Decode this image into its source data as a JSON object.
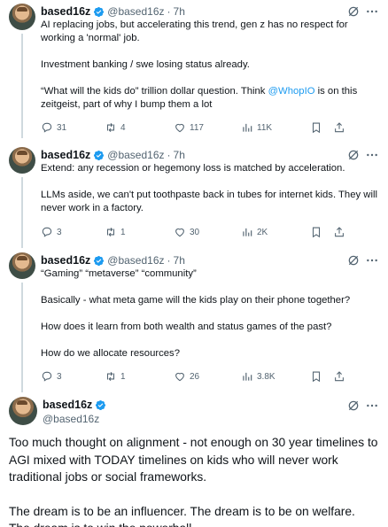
{
  "user": {
    "name": "based16z",
    "handle": "@based16z"
  },
  "colors": {
    "text": "#0f1419",
    "muted": "#536471",
    "link": "#1d9bf0",
    "verified": "#1d9bf0"
  },
  "tweets": [
    {
      "time": "7h",
      "paragraphs": [
        "AI replacing jobs, but accelerating this trend, gen z has no respect for working a 'normal' job.",
        "Investment banking / swe losing status already.",
        "“What will the kids do” trillion dollar question. Think "
      ],
      "mention": "@WhopIO",
      "after_mention": " is on this zeitgeist, part of why I bump them a lot",
      "replies": "31",
      "reposts": "4",
      "likes": "117",
      "views": "11K"
    },
    {
      "time": "7h",
      "paragraphs": [
        "Extend: any recession or hegemony loss is matched by acceleration.",
        "LLMs aside, we can't put toothpaste back in tubes for internet kids. They will never work in a factory."
      ],
      "replies": "3",
      "reposts": "1",
      "likes": "30",
      "views": "2K"
    },
    {
      "time": "7h",
      "paragraphs": [
        "“Gaming” “metaverse” “community”",
        "Basically - what meta game will the kids play on their phone together?",
        "How does it learn from both wealth and status games of the past?",
        "How do we allocate resources?"
      ],
      "replies": "3",
      "reposts": "1",
      "likes": "26",
      "views": "3.8K"
    }
  ],
  "main_tweet": {
    "paragraphs": [
      "Too much thought on alignment - not enough on 30 year timelines to AGI mixed with TODAY timelines on kids who will never work traditional jobs or social frameworks.",
      "The dream is to be an influencer. The dream is to be on welfare. The dream is to win the powerball"
    ]
  },
  "icons": {
    "verified": "verified-badge-icon",
    "grok": "grok-icon",
    "more": "more-icon",
    "reply": "reply-icon",
    "repost": "repost-icon",
    "like": "like-icon",
    "views": "views-icon",
    "bookmark": "bookmark-icon",
    "share": "share-icon"
  }
}
